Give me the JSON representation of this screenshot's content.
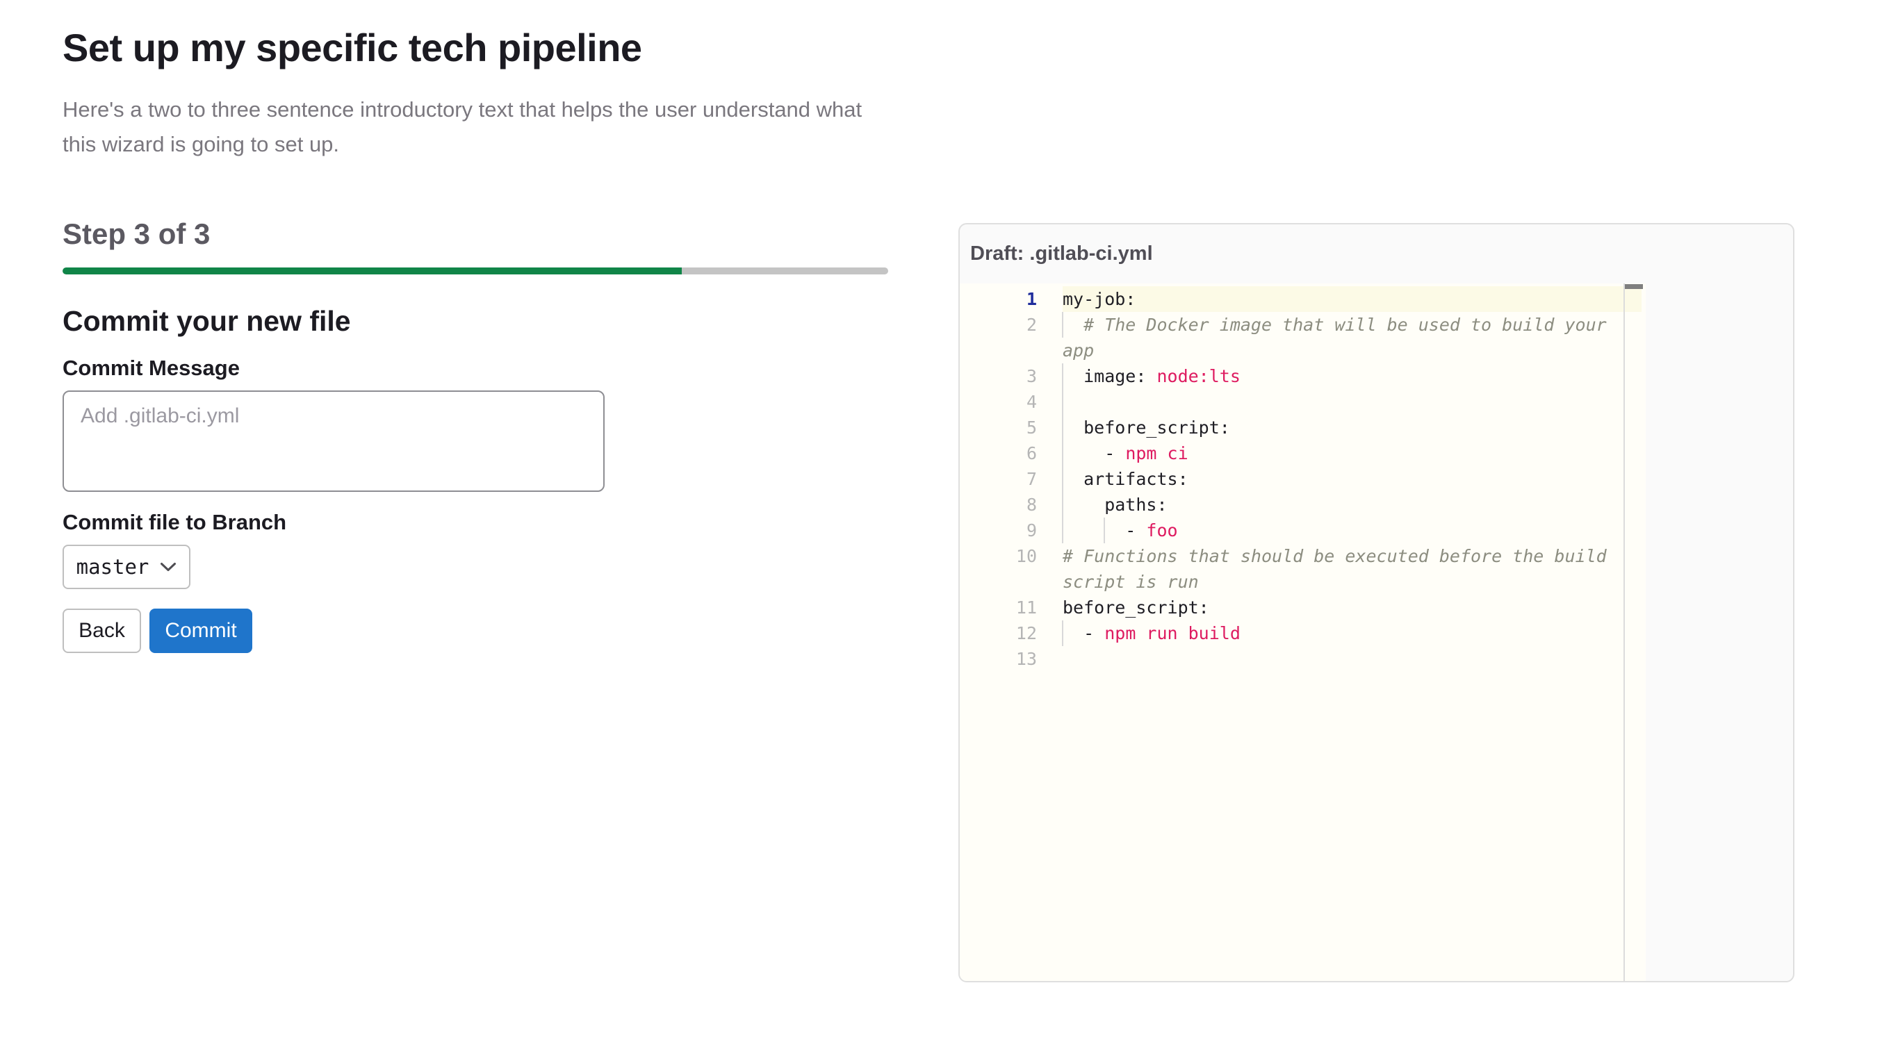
{
  "page": {
    "title": "Set up my specific tech pipeline",
    "intro_lines": [
      "Here's a two to three sentence introductory text that helps the user understand what",
      "this wizard is going to set up."
    ]
  },
  "wizard": {
    "step_heading": "Step 3 of 3",
    "progress_percent": 75,
    "section_heading": "Commit your new file",
    "commit_message": {
      "label": "Commit Message",
      "value": "",
      "placeholder": "Add .gitlab-ci.yml"
    },
    "branch": {
      "label": "Commit file to Branch",
      "selected": "master"
    },
    "buttons": {
      "back": "Back",
      "commit": "Commit"
    }
  },
  "editor_panel": {
    "header": "Draft: .gitlab-ci.yml",
    "rows": [
      {
        "num": "1",
        "active": true,
        "guides": [],
        "segs": [
          {
            "t": "my-job:",
            "c": "k"
          }
        ]
      },
      {
        "num": "2",
        "active": false,
        "guides": [
          0
        ],
        "segs": [
          {
            "t": "  # The Docker image that will be used to build your",
            "c": "c"
          }
        ]
      },
      {
        "num": "",
        "active": false,
        "guides": [],
        "segs": [
          {
            "t": "app",
            "c": "c"
          }
        ]
      },
      {
        "num": "3",
        "active": false,
        "guides": [
          0
        ],
        "segs": [
          {
            "t": "  image: ",
            "c": "k"
          },
          {
            "t": "node:lts",
            "c": "s"
          }
        ]
      },
      {
        "num": "4",
        "active": false,
        "guides": [
          0
        ],
        "segs": []
      },
      {
        "num": "5",
        "active": false,
        "guides": [
          0
        ],
        "segs": [
          {
            "t": "  before_script:",
            "c": "k"
          }
        ]
      },
      {
        "num": "6",
        "active": false,
        "guides": [
          0
        ],
        "segs": [
          {
            "t": "    - ",
            "c": "k"
          },
          {
            "t": "npm ci",
            "c": "s"
          }
        ]
      },
      {
        "num": "7",
        "active": false,
        "guides": [
          0
        ],
        "segs": [
          {
            "t": "  artifacts:",
            "c": "k"
          }
        ]
      },
      {
        "num": "8",
        "active": false,
        "guides": [
          0
        ],
        "segs": [
          {
            "t": "    paths:",
            "c": "k"
          }
        ]
      },
      {
        "num": "9",
        "active": false,
        "guides": [
          0,
          4
        ],
        "segs": [
          {
            "t": "      - ",
            "c": "k"
          },
          {
            "t": "foo",
            "c": "s"
          }
        ]
      },
      {
        "num": "10",
        "active": false,
        "guides": [],
        "segs": [
          {
            "t": "# Functions that should be executed before the build",
            "c": "c"
          }
        ]
      },
      {
        "num": "",
        "active": false,
        "guides": [],
        "segs": [
          {
            "t": "script is run",
            "c": "c"
          }
        ]
      },
      {
        "num": "11",
        "active": false,
        "guides": [],
        "segs": [
          {
            "t": "before_script:",
            "c": "k"
          }
        ]
      },
      {
        "num": "12",
        "active": false,
        "guides": [
          0
        ],
        "segs": [
          {
            "t": "  - ",
            "c": "k"
          },
          {
            "t": "npm run build",
            "c": "s"
          }
        ]
      },
      {
        "num": "13",
        "active": false,
        "guides": [],
        "segs": []
      }
    ]
  },
  "colors": {
    "accent_blue": "#1f75cb",
    "progress_green": "#108548",
    "progress_track": "#c4c4c4",
    "code_string_red": "#de1b60",
    "code_comment": "#8c8d80",
    "active_line_bg": "#fcfae6",
    "active_line_number": "#1f2d9c",
    "panel_bg": "#fafafa"
  }
}
